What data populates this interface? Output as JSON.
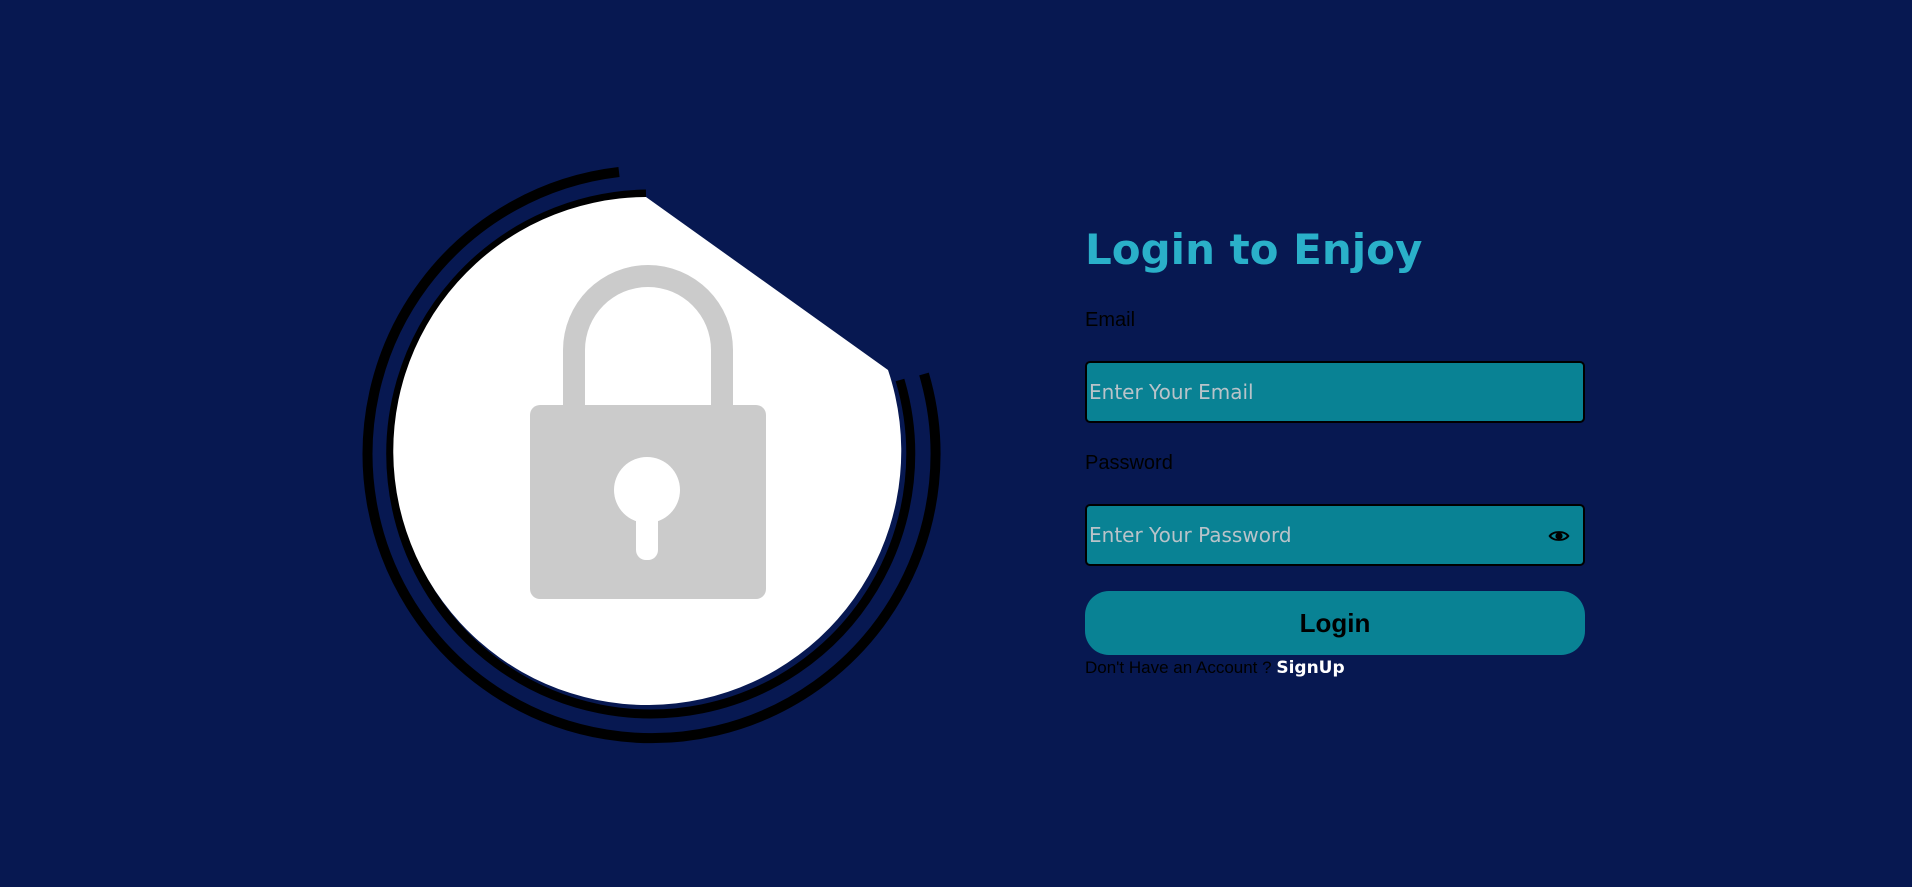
{
  "colors": {
    "background": "#071851",
    "accent": "#2ab0c9",
    "field_background": "#098294",
    "illustration_white": "#ffffff",
    "lock_gray": "#cbcbcb",
    "ring": "#000000"
  },
  "illustration": {
    "icon": "lock-icon"
  },
  "form": {
    "title": "Login to Enjoy",
    "email": {
      "label": "Email",
      "placeholder": "Enter Your Email",
      "value": ""
    },
    "password": {
      "label": "Password",
      "placeholder": "Enter Your Password",
      "value": "",
      "toggle_icon": "eye-icon"
    },
    "login_label": "Login",
    "signup_prompt": "Don't Have an Account ?",
    "signup_label": "SignUp"
  }
}
